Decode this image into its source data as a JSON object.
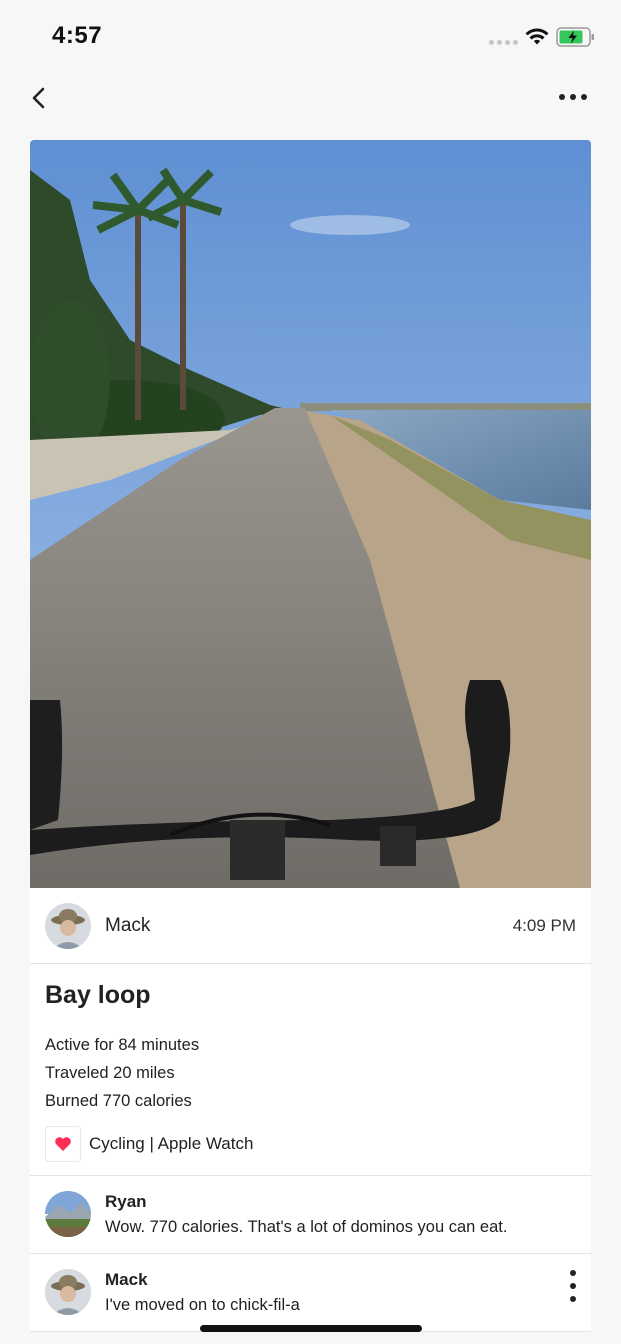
{
  "status_bar": {
    "time": "4:57",
    "icons": [
      "signal-dots",
      "wifi-icon",
      "battery-charging-icon"
    ],
    "battery_color": "#34c759"
  },
  "nav": {
    "back_icon": "chevron-left-icon",
    "more_icon": "more-horizontal-icon"
  },
  "post": {
    "author": "Mack",
    "time": "4:09 PM",
    "title": "Bay loop",
    "stats": [
      "Active for 84 minutes",
      "Traveled 20 miles",
      "Burned 770 calories"
    ],
    "source": "Cycling | Apple Watch",
    "source_icon": "heart-icon",
    "heart_color": "#ff2d55"
  },
  "comments": [
    {
      "name": "Ryan",
      "text": "Wow. 770 calories. That's a lot of dominos you can eat."
    },
    {
      "name": "Mack",
      "text": "I've moved on to chick-fil-a"
    }
  ]
}
